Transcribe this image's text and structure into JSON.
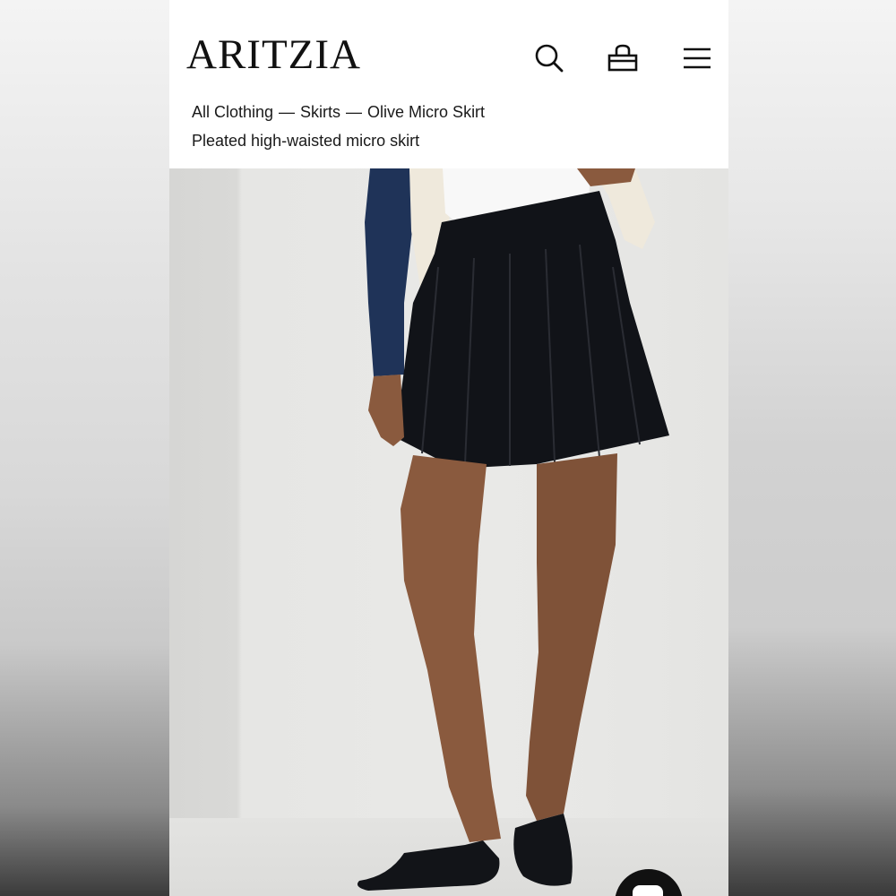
{
  "header": {
    "logo": "ARITZIA",
    "icons": {
      "search": "search-icon",
      "bag": "shopping-bag-icon",
      "menu": "hamburger-menu-icon"
    }
  },
  "breadcrumb": {
    "items": [
      "All Clothing",
      "Skirts",
      "Olive Micro Skirt"
    ],
    "separator": "—"
  },
  "product": {
    "subtitle": "Pleated high-waisted micro skirt"
  },
  "chat": {
    "icon": "chat-bubble-icon"
  },
  "colors": {
    "skirt": "#111318",
    "sweater_navy": "#1f3358",
    "cardigan_cream": "#efe9dc",
    "background": "#ffffff"
  }
}
